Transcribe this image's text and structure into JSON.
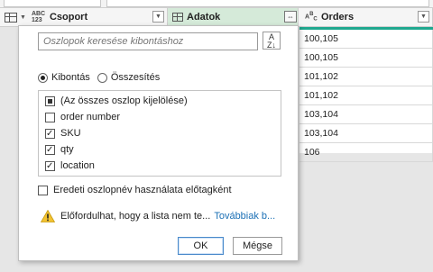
{
  "grid": {
    "columns": [
      {
        "name": "Csoport",
        "type_icon": "ABC 123",
        "kind": "any"
      },
      {
        "name": "Adatok",
        "type_icon": "table-icon",
        "kind": "table"
      },
      {
        "name": "Orders",
        "type_icon": "ABC",
        "kind": "text"
      }
    ],
    "orders_values": [
      "100,105",
      "100,105",
      "101,102",
      "101,102",
      "103,104",
      "103,104",
      "106"
    ],
    "accent_color": "#1fa88f",
    "selected_column_color": "#d5ead9"
  },
  "popup": {
    "search_placeholder": "Oszlopok keresése kibontáshoz",
    "sort_icon": "A↓Z",
    "radio_expand_label": "Kibontás",
    "radio_aggregate_label": "Összesítés",
    "expand_selected": true,
    "columns_list": [
      {
        "label": "(Az összes oszlop kijelölése)",
        "state": "mixed"
      },
      {
        "label": "order number",
        "state": "unchecked"
      },
      {
        "label": "SKU",
        "state": "checked"
      },
      {
        "label": "qty",
        "state": "checked"
      },
      {
        "label": "location",
        "state": "checked"
      }
    ],
    "prefix_label": "Eredeti oszlopnév használata előtagként",
    "prefix_checked": false,
    "warning_text": "Előfordulhat, hogy a lista nem te...",
    "warning_link": "Továbbiak b...",
    "ok_label": "OK",
    "cancel_label": "Mégse"
  }
}
